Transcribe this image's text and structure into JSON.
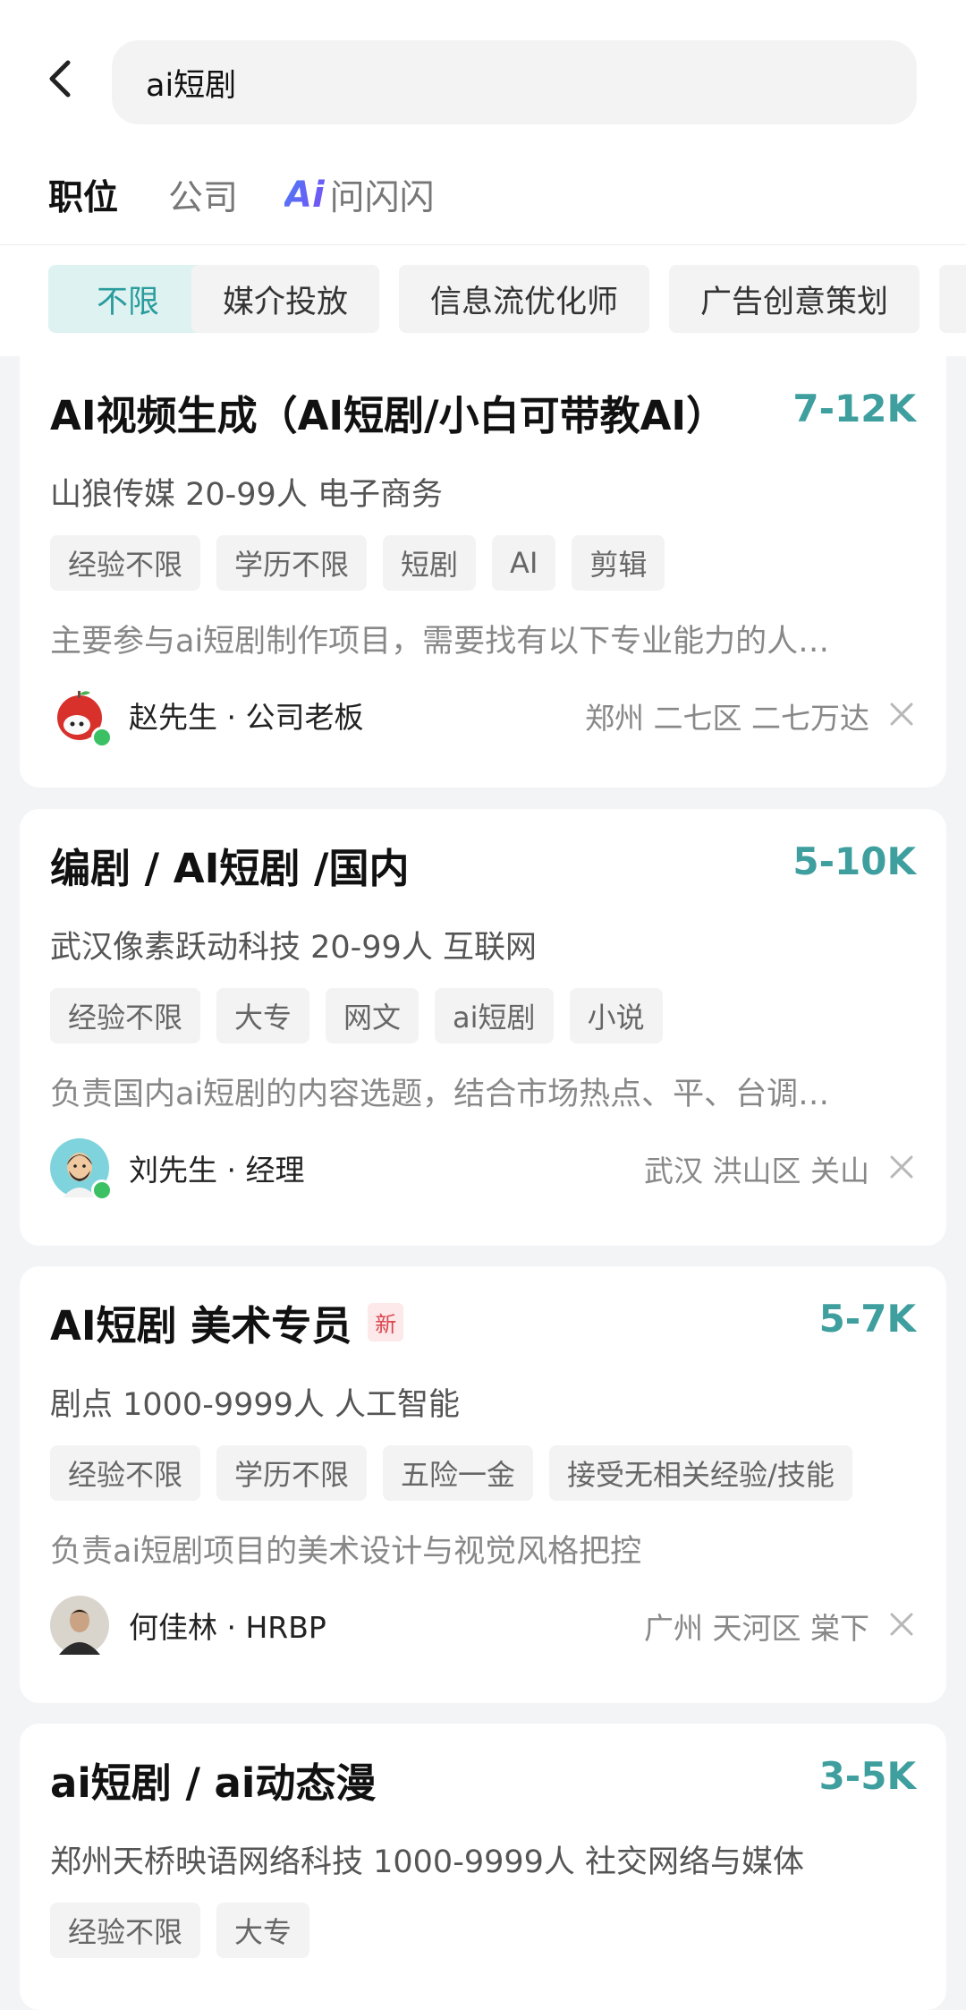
{
  "search": {
    "query": "ai短剧"
  },
  "tabs": [
    {
      "label": "职位",
      "active": true
    },
    {
      "label": "公司",
      "active": false
    },
    {
      "label": "问闪闪",
      "ai_mark": "Ai",
      "active": false
    }
  ],
  "filters": [
    {
      "label": "不限",
      "active": true
    },
    {
      "label": "媒介投放",
      "active": false
    },
    {
      "label": "信息流优化师",
      "active": false
    },
    {
      "label": "广告创意策划",
      "active": false
    }
  ],
  "jobs": [
    {
      "title": "AI视频生成（AI短剧/小白可带教AI）",
      "salary": "7-12K",
      "company": "山狼传媒 20-99人 电子商务",
      "tags": [
        "经验不限",
        "学历不限",
        "短剧",
        "AI",
        "剪辑"
      ],
      "desc": "主要参与ai短剧制作项目，需要找有以下专业能力的人…",
      "recruiter": "赵先生 · 公司老板",
      "location": "郑州 二七区 二七万达",
      "online": true
    },
    {
      "title": "编剧 / AI短剧 /国内",
      "salary": "5-10K",
      "company": "武汉像素跃动科技 20-99人 互联网",
      "tags": [
        "经验不限",
        "大专",
        "网文",
        "ai短剧",
        "小说"
      ],
      "desc": "负责国内ai短剧的内容选题，结合市场热点、平、台调…",
      "recruiter": "刘先生 · 经理",
      "location": "武汉 洪山区 关山",
      "online": true
    },
    {
      "title": "AI短剧 美术专员",
      "new_badge": "新",
      "salary": "5-7K",
      "company": "剧点 1000-9999人 人工智能",
      "tags": [
        "经验不限",
        "学历不限",
        "五险一金",
        "接受无相关经验/技能"
      ],
      "desc": "负责ai短剧项目的美术设计与视觉风格把控",
      "recruiter": "何佳林 · HRBP",
      "location": "广州 天河区 棠下",
      "online": false
    },
    {
      "title": "ai短剧 / ai动态漫",
      "salary": "3-5K",
      "company": "郑州天桥映语网络科技 1000-9999人 社交网络与媒体",
      "tags": [
        "经验不限",
        "大专"
      ]
    }
  ],
  "colors": {
    "accent": "#3f9f9f",
    "online": "#3cc064",
    "chip_active_bg": "#dff2f2"
  }
}
